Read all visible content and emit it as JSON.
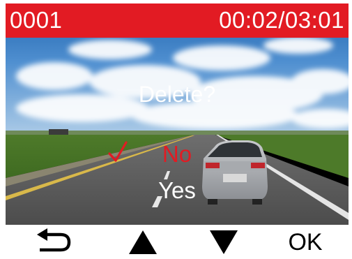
{
  "status_bar": {
    "file_number": "0001",
    "timecode": "00:02/03:01",
    "color": "#e21b23"
  },
  "dialog": {
    "prompt": "Delete?",
    "options": [
      {
        "label": "No",
        "selected": true
      },
      {
        "label": "Yes",
        "selected": false
      }
    ],
    "selected_color": "#e21b23",
    "check_icon": "checkmark-icon"
  },
  "controls": {
    "back_icon": "back-return-icon",
    "up_icon": "up-triangle-icon",
    "down_icon": "down-triangle-icon",
    "ok_label": "OK"
  }
}
